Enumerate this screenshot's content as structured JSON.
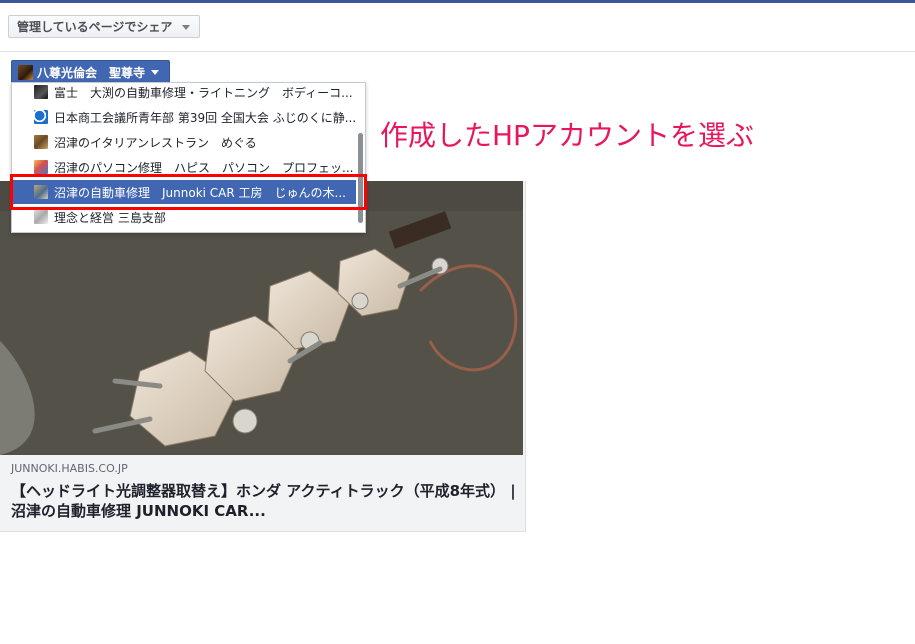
{
  "share_dropdown": {
    "label": "管理しているページでシェア"
  },
  "page_selector": {
    "label": "八尊光倫会　聖尊寺"
  },
  "page_menu": {
    "items": [
      {
        "label": "富士　大渕の自動車修理・ライトニング　ボディーコ...",
        "icon": "page-avatar-icon"
      },
      {
        "label": "日本商工会議所青年部 第39回 全国大会 ふじのくに静...",
        "icon": "page-avatar-icon"
      },
      {
        "label": "沼津のイタリアンレストラン　めぐる",
        "icon": "page-avatar-icon"
      },
      {
        "label": "沼津のパソコン修理　ハピス　パソコン　プロフェッ...",
        "icon": "page-avatar-icon"
      },
      {
        "label": "沼津の自動車修理　Junnoki CAR 工房　じゅんの木...",
        "icon": "page-avatar-icon",
        "selected": true
      },
      {
        "label": "理念と経営 三島支部",
        "icon": "page-avatar-icon"
      }
    ]
  },
  "annotation": {
    "text": "作成したHPアカウントを選ぶ",
    "color": "#e8175d"
  },
  "link_preview": {
    "domain": "JUNNOKI.HABIS.CO.JP",
    "title": "【ヘッドライト光調整器取替え】ホンダ アクティトラック（平成8年式） | 沼津の自動車修理 JUNNOKI CAR..."
  },
  "colors": {
    "brand": "#3b5998",
    "selector_bg": "#4267b2",
    "highlight": "#ff0000"
  }
}
